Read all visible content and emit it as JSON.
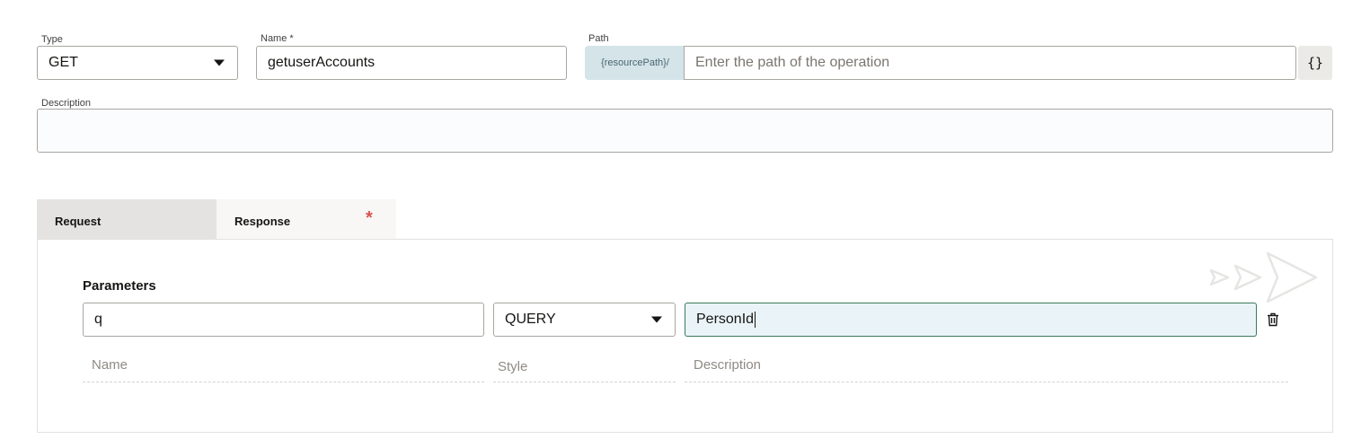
{
  "form": {
    "type": {
      "label": "Type",
      "value": "GET"
    },
    "name": {
      "label": "Name",
      "required_mark": "*",
      "value": "getuserAccounts"
    },
    "path": {
      "label": "Path",
      "prefix": "{resourcePath}/",
      "placeholder": "Enter the path of the operation",
      "braces_label": "{}"
    },
    "description": {
      "label": "Description",
      "value": ""
    }
  },
  "tabs": [
    {
      "label": "Request",
      "active": true
    },
    {
      "label": "Response",
      "required_mark": "*",
      "active": false
    }
  ],
  "parameters": {
    "title": "Parameters",
    "row": {
      "name": "q",
      "style": "QUERY",
      "description": "PersonId"
    },
    "hints": {
      "name": "Name",
      "style": "Style",
      "description": "Description"
    }
  },
  "icons": {
    "type_dropdown": "chevron-down-icon",
    "style_dropdown": "chevron-down-icon",
    "delete": "trash-icon",
    "watermark": "paper-plane-icon"
  },
  "colors": {
    "prefix_bg": "#d4e4e9",
    "active_field_bg": "#eaf4f8",
    "active_field_border": "#3a7a59",
    "required_star": "#d9534f"
  }
}
